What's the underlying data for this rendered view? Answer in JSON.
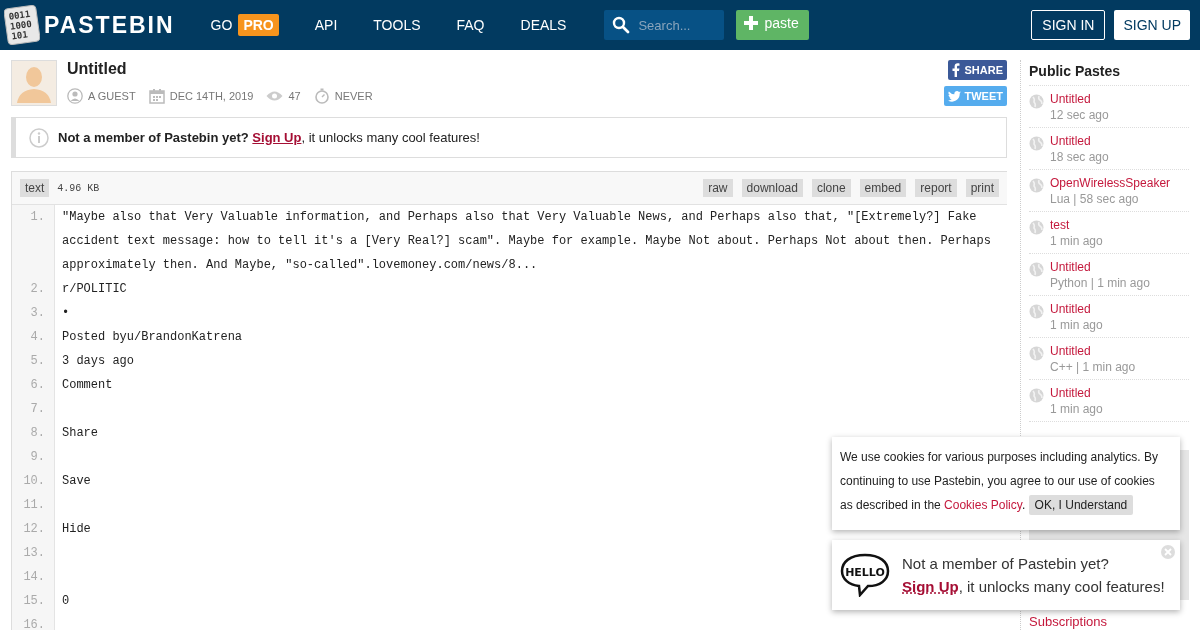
{
  "header": {
    "logo_icon_text": [
      "0011",
      "1000",
      "101"
    ],
    "logo": "PASTEBIN",
    "nav": [
      {
        "label": "GO",
        "badge": "PRO"
      },
      {
        "label": "API"
      },
      {
        "label": "TOOLS"
      },
      {
        "label": "FAQ"
      },
      {
        "label": "DEALS"
      }
    ],
    "search": {
      "placeholder": "Search..."
    },
    "paste_button": "paste",
    "sign_in": "SIGN IN",
    "sign_up": "SIGN UP"
  },
  "paste": {
    "title": "Untitled",
    "author": "A GUEST",
    "date": "DEC 14TH, 2019",
    "views": "47",
    "expires": "NEVER",
    "share": "SHARE",
    "tweet": "TWEET"
  },
  "notice": {
    "lead": "Not a member of Pastebin yet?",
    "link": "Sign Up",
    "rest": ", it unlocks many cool features!"
  },
  "code": {
    "syntax": "text",
    "size": "4.96 KB",
    "actions": [
      "raw",
      "download",
      "clone",
      "embed",
      "report",
      "print"
    ],
    "lines": [
      {
        "no": "1.",
        "text": "\"Maybe also that Very Valuable information, and Perhaps also that Very Valuable News, and Perhaps also that, \"[Extremely?] Fake accident text message: how to tell it's a [Very Real?] scam\". Maybe for example. Maybe Not about. Perhaps Not about then. Perhaps approximately then. And Maybe, \"so-called\".lovemoney.com/news/8..."
      },
      {
        "no": "2.",
        "text": "r/POLITIC"
      },
      {
        "no": "3.",
        "text": "•"
      },
      {
        "no": "4.",
        "text": "Posted byu/BrandonKatrena"
      },
      {
        "no": "5.",
        "text": "3 days ago"
      },
      {
        "no": "6.",
        "text": "Comment"
      },
      {
        "no": "7."
      },
      {
        "no": "8.",
        "text": "Share"
      },
      {
        "no": "9."
      },
      {
        "no": "10.",
        "text": "Save"
      },
      {
        "no": "11."
      },
      {
        "no": "12.",
        "text": "Hide"
      },
      {
        "no": "13."
      },
      {
        "no": "14."
      },
      {
        "no": "15.",
        "text": "0"
      },
      {
        "no": "16."
      }
    ]
  },
  "sidebar": {
    "title": "Public Pastes",
    "items": [
      {
        "title": "Untitled",
        "meta": "12 sec ago"
      },
      {
        "title": "Untitled",
        "meta": "18 sec ago"
      },
      {
        "title": "OpenWirelessSpeaker",
        "meta": "Lua | 58 sec ago"
      },
      {
        "title": "test",
        "meta": "1 min ago"
      },
      {
        "title": "Untitled",
        "meta": "Python | 1 min ago"
      },
      {
        "title": "Untitled",
        "meta": "1 min ago"
      },
      {
        "title": "Untitled",
        "meta": "C++ | 1 min ago"
      },
      {
        "title": "Untitled",
        "meta": "1 min ago"
      }
    ],
    "subscriptions_link": "Subscriptions"
  },
  "cookie_popup": {
    "text": "We use cookies for various purposes including analytics. By continuing to use Pastebin, you agree to our use of cookies as described in the",
    "link": "Cookies Policy",
    "after": ".",
    "button": "OK, I Understand"
  },
  "hello_popup": {
    "icon_text": "HELLO",
    "line1": "Not a member of Pastebin yet?",
    "link": "Sign Up",
    "rest": ", it unlocks many cool features!"
  }
}
